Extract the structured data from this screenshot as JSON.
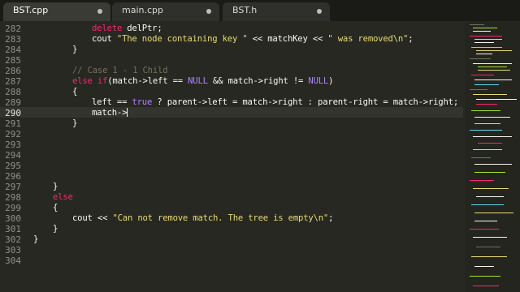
{
  "tabs": [
    {
      "label": "BST.cpp",
      "active": true
    },
    {
      "label": "main.cpp",
      "active": false
    },
    {
      "label": "BST.h",
      "active": false
    }
  ],
  "editor": {
    "current_line": 290,
    "lines": [
      {
        "num": 282
      },
      {
        "num": 283
      },
      {
        "num": 284
      },
      {
        "num": 285
      },
      {
        "num": 286
      },
      {
        "num": 287
      },
      {
        "num": 288
      },
      {
        "num": 289
      },
      {
        "num": 290
      },
      {
        "num": 291
      },
      {
        "num": 292
      },
      {
        "num": 293
      },
      {
        "num": 294
      },
      {
        "num": 295
      },
      {
        "num": 296
      },
      {
        "num": 297
      },
      {
        "num": 298
      },
      {
        "num": 299
      },
      {
        "num": 300
      },
      {
        "num": 301
      },
      {
        "num": 302
      },
      {
        "num": 303
      },
      {
        "num": 304
      }
    ],
    "code": {
      "l282": {
        "kw": "delete",
        "rest": " delPtr;"
      },
      "l283": {
        "pre": "cout ",
        "s1": "\"The node containing key \"",
        "mid": " << matchKey << ",
        "s2": "\" was removed\\n\"",
        "end": ";"
      },
      "l284": {
        "text": "}"
      },
      "l286": {
        "comment": "// Case 1 - 1 Child"
      },
      "l287": {
        "kw": "else if",
        "pre": "(match->left == ",
        "c1": "NULL",
        "mid": " && match->right != ",
        "c2": "NULL",
        "end": ")"
      },
      "l288": {
        "text": "{"
      },
      "l289": {
        "pre": "left == ",
        "c1": "true",
        "rest": " ? parent->left = match->right : parent-right = match->right;"
      },
      "l290": {
        "text": "match->"
      },
      "l291": {
        "text": "}"
      },
      "l297": {
        "text": "}"
      },
      "l298": {
        "kw": "else"
      },
      "l299": {
        "text": "{"
      },
      "l300": {
        "pre": "cout << ",
        "s1": "\"Can not remove match. The tree is empty\\n\"",
        "end": ";"
      },
      "l301": {
        "text": "}"
      },
      "l302": {
        "text": "}"
      }
    }
  },
  "minimap": {
    "icon": "minimap-icon"
  }
}
